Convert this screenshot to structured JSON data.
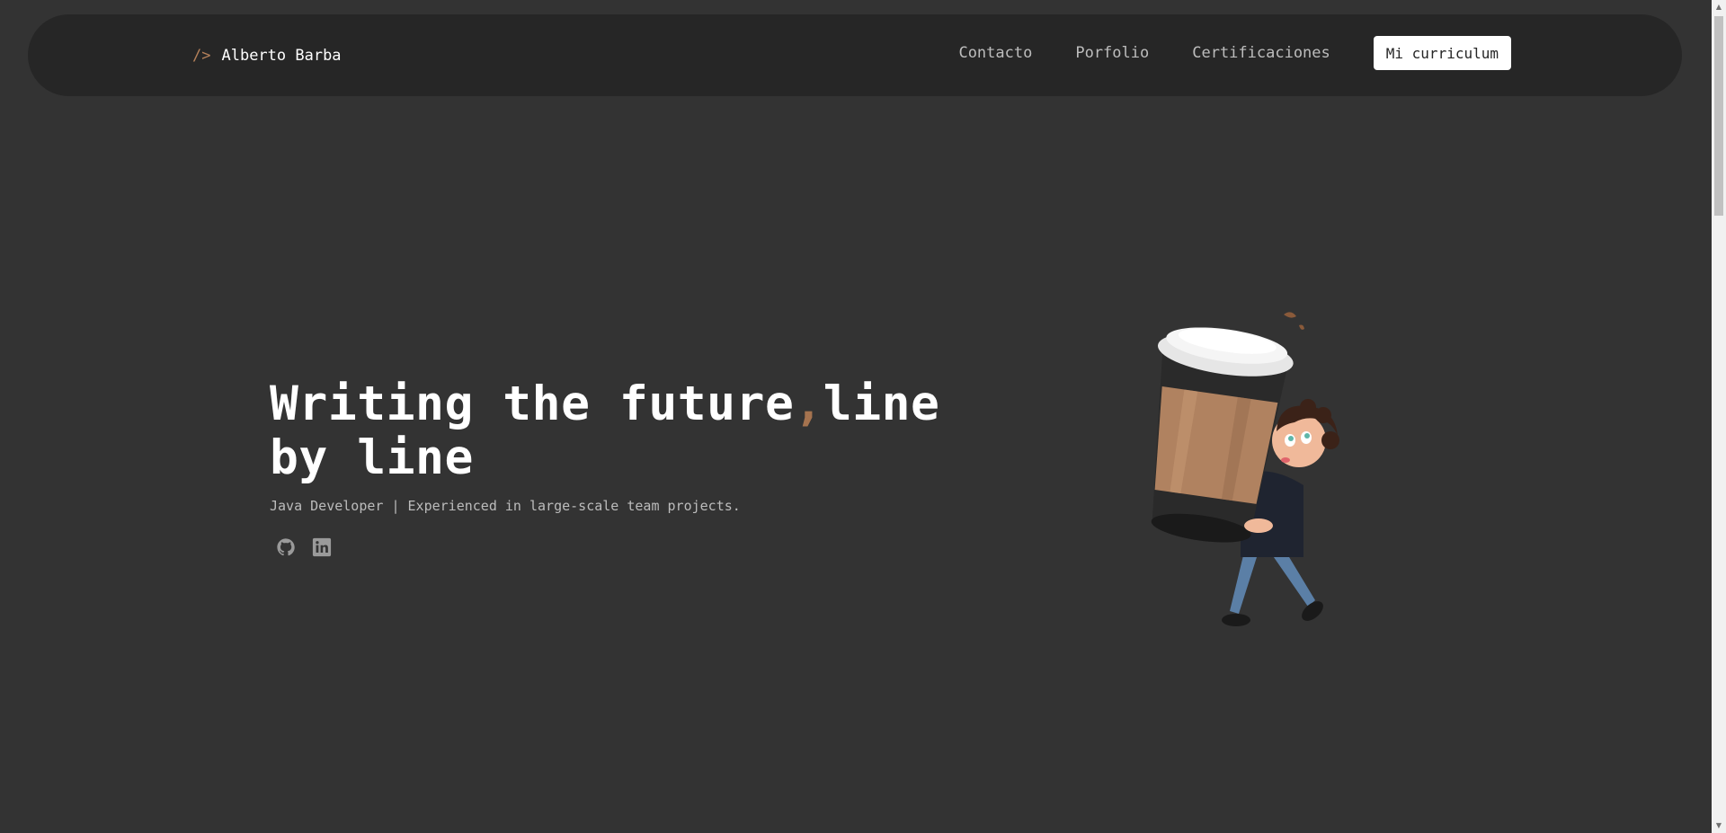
{
  "navbar": {
    "brand_mark": "/>",
    "brand_name": "Alberto Barba",
    "links": [
      "Contacto",
      "Porfolio",
      "Certificaciones"
    ],
    "cv_button": "Mi curriculum"
  },
  "hero": {
    "title_part1": "Writing the future",
    "title_separator": ",",
    "title_part2": "line by line",
    "subtitle": "Java Developer | Experienced in large-scale team projects."
  },
  "socials": [
    {
      "icon": "github-icon"
    },
    {
      "icon": "linkedin-icon"
    }
  ],
  "illustration": {
    "icon": "avatar-carrying-coffee-cup"
  },
  "colors": {
    "background": "#333333",
    "navbar": "#262626",
    "accent": "#a5734f",
    "text": "#ffffff",
    "muted": "#bcbcbc"
  }
}
